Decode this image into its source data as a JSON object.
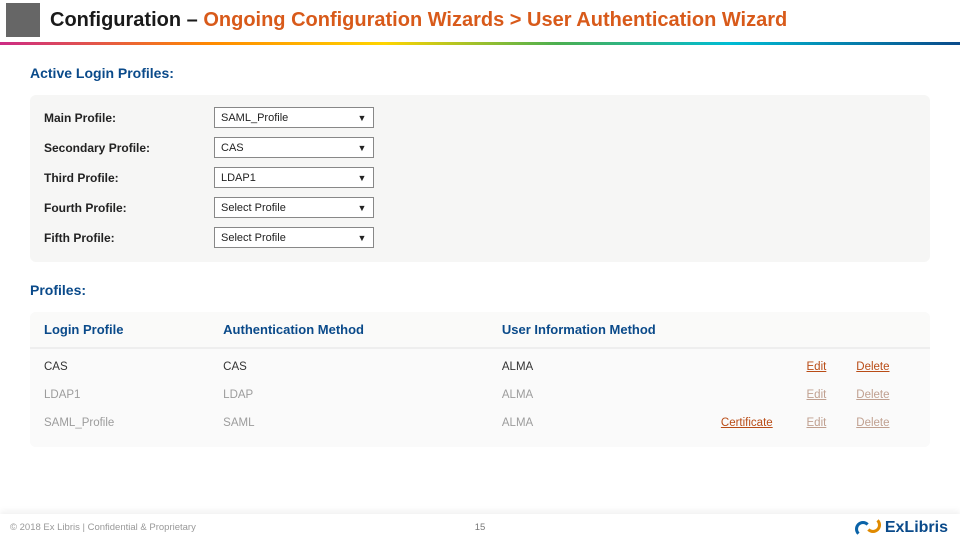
{
  "title": {
    "prefix": "Configuration – ",
    "highlight": "Ongoing Configuration Wizards > User Authentication Wizard"
  },
  "sections": {
    "active_login_profiles": "Active Login Profiles:",
    "profiles": "Profiles:"
  },
  "active_profiles": [
    {
      "label": "Main Profile:",
      "value": "SAML_Profile"
    },
    {
      "label": "Secondary Profile:",
      "value": "CAS"
    },
    {
      "label": "Third Profile:",
      "value": "LDAP1"
    },
    {
      "label": "Fourth Profile:",
      "value": "Select Profile"
    },
    {
      "label": "Fifth Profile:",
      "value": "Select Profile"
    }
  ],
  "table": {
    "headers": {
      "login_profile": "Login Profile",
      "auth_method": "Authentication Method",
      "user_info_method": "User Information Method"
    },
    "rows": [
      {
        "login": "CAS",
        "auth": "CAS",
        "user": "ALMA",
        "cert": "",
        "edit": "Edit",
        "del": "Delete",
        "muted": false
      },
      {
        "login": "LDAP1",
        "auth": "LDAP",
        "user": "ALMA",
        "cert": "",
        "edit": "Edit",
        "del": "Delete",
        "muted": true
      },
      {
        "login": "SAML_Profile",
        "auth": "SAML",
        "user": "ALMA",
        "cert": "Certificate",
        "edit": "Edit",
        "del": "Delete",
        "muted": true
      }
    ]
  },
  "footer": {
    "copyright": "© 2018 Ex Libris | Confidential & Proprietary",
    "page": "15",
    "logo": "ExLibris"
  }
}
